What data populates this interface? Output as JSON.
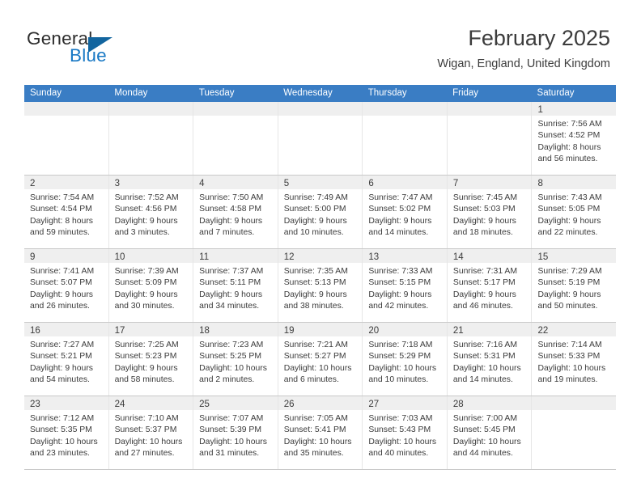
{
  "brand": {
    "name_top": "General",
    "name_bottom": "Blue",
    "triangle_icon": "blue-triangle-logo-mark",
    "accent_color": "#1878c4",
    "logo_mark_color": "#12659f"
  },
  "header": {
    "title": "February 2025",
    "subtitle": "Wigan, England, United Kingdom",
    "header_row_color": "#3a7dc4"
  },
  "weekdays": [
    "Sunday",
    "Monday",
    "Tuesday",
    "Wednesday",
    "Thursday",
    "Friday",
    "Saturday"
  ],
  "weeks": [
    [
      {
        "day": "",
        "lines": []
      },
      {
        "day": "",
        "lines": []
      },
      {
        "day": "",
        "lines": []
      },
      {
        "day": "",
        "lines": []
      },
      {
        "day": "",
        "lines": []
      },
      {
        "day": "",
        "lines": []
      },
      {
        "day": "1",
        "lines": [
          "Sunrise: 7:56 AM",
          "Sunset: 4:52 PM",
          "Daylight: 8 hours",
          "and 56 minutes."
        ]
      }
    ],
    [
      {
        "day": "2",
        "lines": [
          "Sunrise: 7:54 AM",
          "Sunset: 4:54 PM",
          "Daylight: 8 hours",
          "and 59 minutes."
        ]
      },
      {
        "day": "3",
        "lines": [
          "Sunrise: 7:52 AM",
          "Sunset: 4:56 PM",
          "Daylight: 9 hours",
          "and 3 minutes."
        ]
      },
      {
        "day": "4",
        "lines": [
          "Sunrise: 7:50 AM",
          "Sunset: 4:58 PM",
          "Daylight: 9 hours",
          "and 7 minutes."
        ]
      },
      {
        "day": "5",
        "lines": [
          "Sunrise: 7:49 AM",
          "Sunset: 5:00 PM",
          "Daylight: 9 hours",
          "and 10 minutes."
        ]
      },
      {
        "day": "6",
        "lines": [
          "Sunrise: 7:47 AM",
          "Sunset: 5:02 PM",
          "Daylight: 9 hours",
          "and 14 minutes."
        ]
      },
      {
        "day": "7",
        "lines": [
          "Sunrise: 7:45 AM",
          "Sunset: 5:03 PM",
          "Daylight: 9 hours",
          "and 18 minutes."
        ]
      },
      {
        "day": "8",
        "lines": [
          "Sunrise: 7:43 AM",
          "Sunset: 5:05 PM",
          "Daylight: 9 hours",
          "and 22 minutes."
        ]
      }
    ],
    [
      {
        "day": "9",
        "lines": [
          "Sunrise: 7:41 AM",
          "Sunset: 5:07 PM",
          "Daylight: 9 hours",
          "and 26 minutes."
        ]
      },
      {
        "day": "10",
        "lines": [
          "Sunrise: 7:39 AM",
          "Sunset: 5:09 PM",
          "Daylight: 9 hours",
          "and 30 minutes."
        ]
      },
      {
        "day": "11",
        "lines": [
          "Sunrise: 7:37 AM",
          "Sunset: 5:11 PM",
          "Daylight: 9 hours",
          "and 34 minutes."
        ]
      },
      {
        "day": "12",
        "lines": [
          "Sunrise: 7:35 AM",
          "Sunset: 5:13 PM",
          "Daylight: 9 hours",
          "and 38 minutes."
        ]
      },
      {
        "day": "13",
        "lines": [
          "Sunrise: 7:33 AM",
          "Sunset: 5:15 PM",
          "Daylight: 9 hours",
          "and 42 minutes."
        ]
      },
      {
        "day": "14",
        "lines": [
          "Sunrise: 7:31 AM",
          "Sunset: 5:17 PM",
          "Daylight: 9 hours",
          "and 46 minutes."
        ]
      },
      {
        "day": "15",
        "lines": [
          "Sunrise: 7:29 AM",
          "Sunset: 5:19 PM",
          "Daylight: 9 hours",
          "and 50 minutes."
        ]
      }
    ],
    [
      {
        "day": "16",
        "lines": [
          "Sunrise: 7:27 AM",
          "Sunset: 5:21 PM",
          "Daylight: 9 hours",
          "and 54 minutes."
        ]
      },
      {
        "day": "17",
        "lines": [
          "Sunrise: 7:25 AM",
          "Sunset: 5:23 PM",
          "Daylight: 9 hours",
          "and 58 minutes."
        ]
      },
      {
        "day": "18",
        "lines": [
          "Sunrise: 7:23 AM",
          "Sunset: 5:25 PM",
          "Daylight: 10 hours",
          "and 2 minutes."
        ]
      },
      {
        "day": "19",
        "lines": [
          "Sunrise: 7:21 AM",
          "Sunset: 5:27 PM",
          "Daylight: 10 hours",
          "and 6 minutes."
        ]
      },
      {
        "day": "20",
        "lines": [
          "Sunrise: 7:18 AM",
          "Sunset: 5:29 PM",
          "Daylight: 10 hours",
          "and 10 minutes."
        ]
      },
      {
        "day": "21",
        "lines": [
          "Sunrise: 7:16 AM",
          "Sunset: 5:31 PM",
          "Daylight: 10 hours",
          "and 14 minutes."
        ]
      },
      {
        "day": "22",
        "lines": [
          "Sunrise: 7:14 AM",
          "Sunset: 5:33 PM",
          "Daylight: 10 hours",
          "and 19 minutes."
        ]
      }
    ],
    [
      {
        "day": "23",
        "lines": [
          "Sunrise: 7:12 AM",
          "Sunset: 5:35 PM",
          "Daylight: 10 hours",
          "and 23 minutes."
        ]
      },
      {
        "day": "24",
        "lines": [
          "Sunrise: 7:10 AM",
          "Sunset: 5:37 PM",
          "Daylight: 10 hours",
          "and 27 minutes."
        ]
      },
      {
        "day": "25",
        "lines": [
          "Sunrise: 7:07 AM",
          "Sunset: 5:39 PM",
          "Daylight: 10 hours",
          "and 31 minutes."
        ]
      },
      {
        "day": "26",
        "lines": [
          "Sunrise: 7:05 AM",
          "Sunset: 5:41 PM",
          "Daylight: 10 hours",
          "and 35 minutes."
        ]
      },
      {
        "day": "27",
        "lines": [
          "Sunrise: 7:03 AM",
          "Sunset: 5:43 PM",
          "Daylight: 10 hours",
          "and 40 minutes."
        ]
      },
      {
        "day": "28",
        "lines": [
          "Sunrise: 7:00 AM",
          "Sunset: 5:45 PM",
          "Daylight: 10 hours",
          "and 44 minutes."
        ]
      },
      {
        "day": "",
        "lines": []
      }
    ]
  ]
}
